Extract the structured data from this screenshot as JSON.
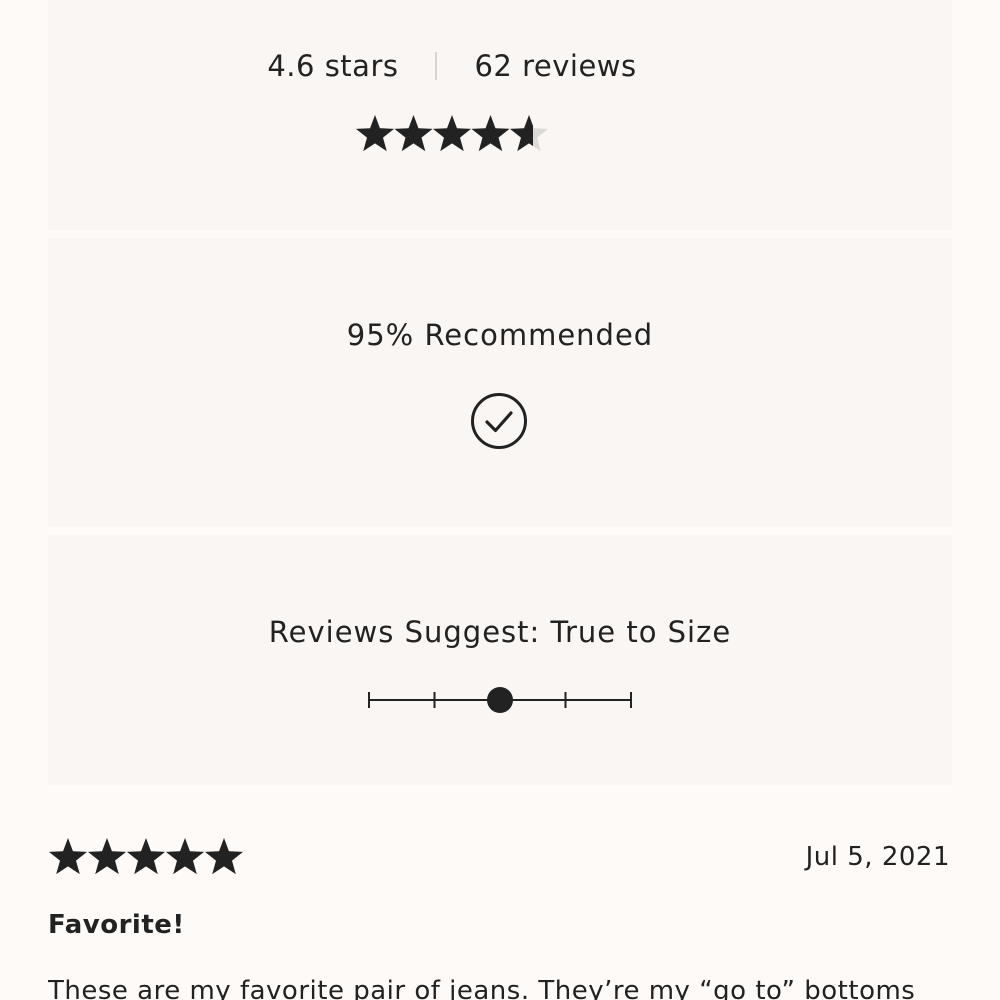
{
  "summary": {
    "rating_text": "4.6 stars",
    "reviews_text": "62 reviews",
    "rating_value": 4.6,
    "rating_max": 5
  },
  "recommend": {
    "text": "95% Recommended",
    "icon": "check-circle-icon"
  },
  "size": {
    "text": "Reviews Suggest: True to Size",
    "scale_position": 0.5,
    "scale_steps": 5
  },
  "review": {
    "rating_value": 5,
    "date": "Jul 5, 2021",
    "title": "Favorite!",
    "body": "These are my favorite pair of jeans. They’re my “go to” bottoms"
  },
  "colors": {
    "star_filled": "#222222",
    "star_empty": "#dcdad6",
    "background": "#fdfaf8",
    "card": "#f9f6f3"
  }
}
